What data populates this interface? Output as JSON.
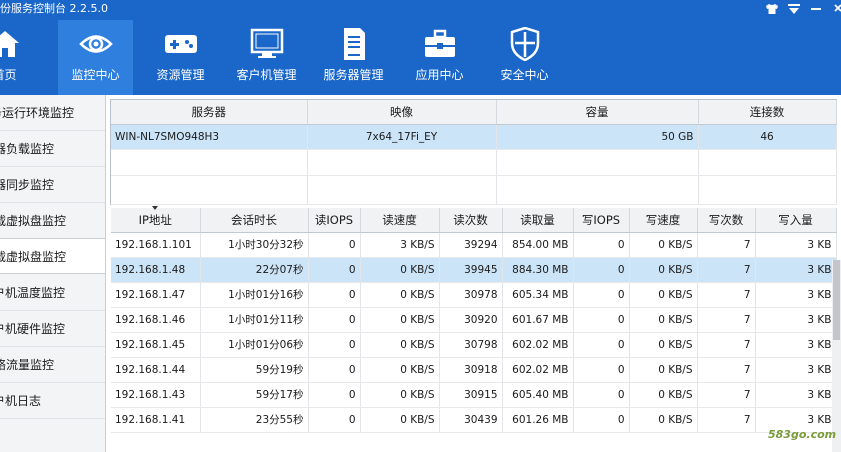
{
  "app": {
    "title": "份服务控制台 2.2.5.0"
  },
  "nav": [
    {
      "label": "首页",
      "icon": "home-icon"
    },
    {
      "label": "监控中心",
      "icon": "eye-icon",
      "active": true
    },
    {
      "label": "资源管理",
      "icon": "gamepad-icon"
    },
    {
      "label": "客户机管理",
      "icon": "monitor-icon"
    },
    {
      "label": "服务器管理",
      "icon": "server-icon"
    },
    {
      "label": "应用中心",
      "icon": "toolbox-icon"
    },
    {
      "label": "安全中心",
      "icon": "shield-icon"
    }
  ],
  "sidebar": [
    {
      "label": "务运行环境监控"
    },
    {
      "label": "器负载监控"
    },
    {
      "label": "器同步监控"
    },
    {
      "label": "载虚拟盘监控"
    },
    {
      "label": "载虚拟盘监控",
      "active": true
    },
    {
      "label": "户机温度监控"
    },
    {
      "label": "户机硬件监控"
    },
    {
      "label": "络流量监控"
    },
    {
      "label": "户机日志"
    }
  ],
  "server_table": {
    "columns": [
      "服务器",
      "映像",
      "容量",
      "连接数"
    ],
    "rows": [
      {
        "server": "WIN-NL7SMO948H3",
        "image": "7x64_17Fi_EY",
        "capacity": "50 GB",
        "connections": "46"
      }
    ]
  },
  "session_table": {
    "columns": [
      "IP地址",
      "会话时长",
      "读IOPS",
      "读速度",
      "读次数",
      "读取量",
      "写IOPS",
      "写速度",
      "写次数",
      "写入量"
    ],
    "rows": [
      [
        "192.168.1.101",
        "1小时30分32秒",
        "0",
        "3 KB/S",
        "39294",
        "854.00 MB",
        "0",
        "0 KB/S",
        "7",
        "3 KB"
      ],
      [
        "192.168.1.48",
        "22分07秒",
        "0",
        "0 KB/S",
        "39945",
        "884.30 MB",
        "0",
        "0 KB/S",
        "7",
        "3 KB"
      ],
      [
        "192.168.1.47",
        "1小时01分16秒",
        "0",
        "0 KB/S",
        "30978",
        "605.34 MB",
        "0",
        "0 KB/S",
        "7",
        "3 KB"
      ],
      [
        "192.168.1.46",
        "1小时01分11秒",
        "0",
        "0 KB/S",
        "30920",
        "601.67 MB",
        "0",
        "0 KB/S",
        "7",
        "3 KB"
      ],
      [
        "192.168.1.45",
        "1小时01分06秒",
        "0",
        "0 KB/S",
        "30798",
        "602.02 MB",
        "0",
        "0 KB/S",
        "7",
        "3 KB"
      ],
      [
        "192.168.1.44",
        "59分19秒",
        "0",
        "0 KB/S",
        "30918",
        "602.02 MB",
        "0",
        "0 KB/S",
        "7",
        "3 KB"
      ],
      [
        "192.168.1.43",
        "59分17秒",
        "0",
        "0 KB/S",
        "30915",
        "605.40 MB",
        "0",
        "0 KB/S",
        "7",
        "3 KB"
      ],
      [
        "192.168.1.41",
        "23分55秒",
        "0",
        "0 KB/S",
        "30439",
        "601.26 MB",
        "0",
        "0 KB/S",
        "7",
        "3 KB"
      ]
    ],
    "selected_row": 1
  },
  "watermark": "583go.com",
  "colors": {
    "header_bg": "#1a66c9",
    "nav_active": "#2f7fde",
    "row_selected": "#cce4f7"
  }
}
